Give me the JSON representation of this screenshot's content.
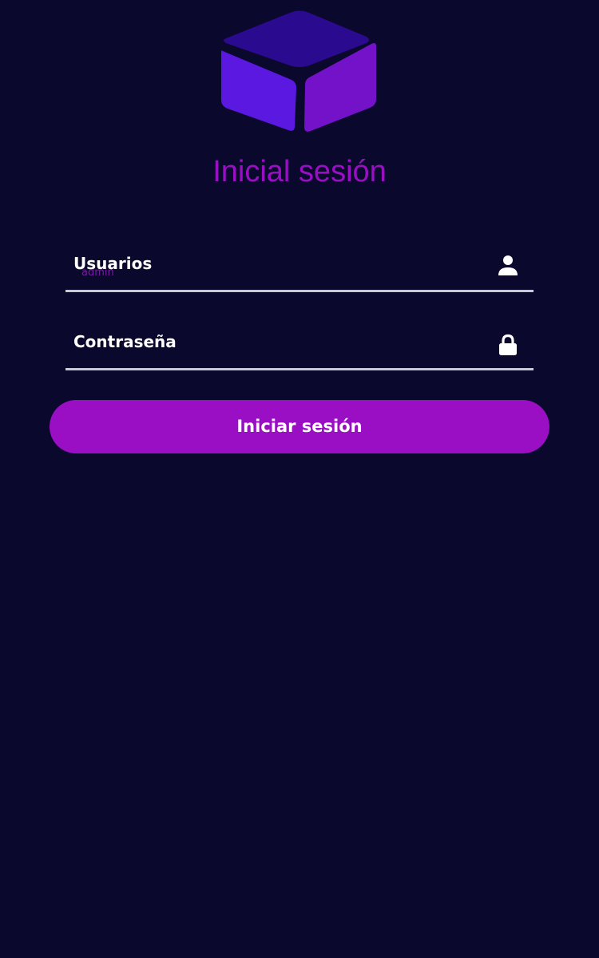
{
  "colors": {
    "background": "#0b082e",
    "accent": "#9a0ec4",
    "title": "#9a0ec4",
    "input_underline": "#c9c9cf",
    "text": "#ffffff"
  },
  "header": {
    "logo_icon": "cube-icon",
    "title": "Inicial sesión"
  },
  "form": {
    "username": {
      "label": "Usuarios",
      "value": "admin",
      "icon": "user-icon"
    },
    "password": {
      "label": "Contraseña",
      "icon": "lock-icon"
    },
    "submit_label": "Iniciar sesión"
  }
}
